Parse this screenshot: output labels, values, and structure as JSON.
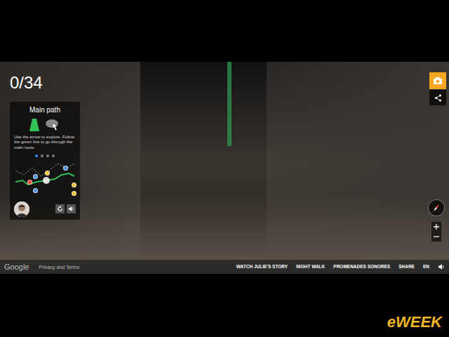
{
  "counter": "0/34",
  "panel": {
    "title": "Main path",
    "instructions": "Use the arrow to explore. Follow the green line to go through the main route.",
    "pages": [
      {
        "selected": true
      },
      {
        "selected": false
      },
      {
        "selected": false
      },
      {
        "selected": false
      }
    ],
    "map": {
      "pins": [
        {
          "color": "#f2c12e"
        },
        {
          "color": "#4a8ee6"
        },
        {
          "color": "#e8412c"
        },
        {
          "color": "#4a8ee6"
        },
        {
          "color": "#4a8ee6"
        },
        {
          "color": "#f2c12e"
        },
        {
          "color": "#f2c12e"
        }
      ]
    }
  },
  "footer": {
    "logo": "Google",
    "privacy": "Privacy and Terms",
    "links": [
      "WATCH JULIE'S STORY",
      "NIGHT WALK",
      "PROMENADES SONORES",
      "SHARE"
    ],
    "language": "EN"
  },
  "watermark": "eWEEK"
}
